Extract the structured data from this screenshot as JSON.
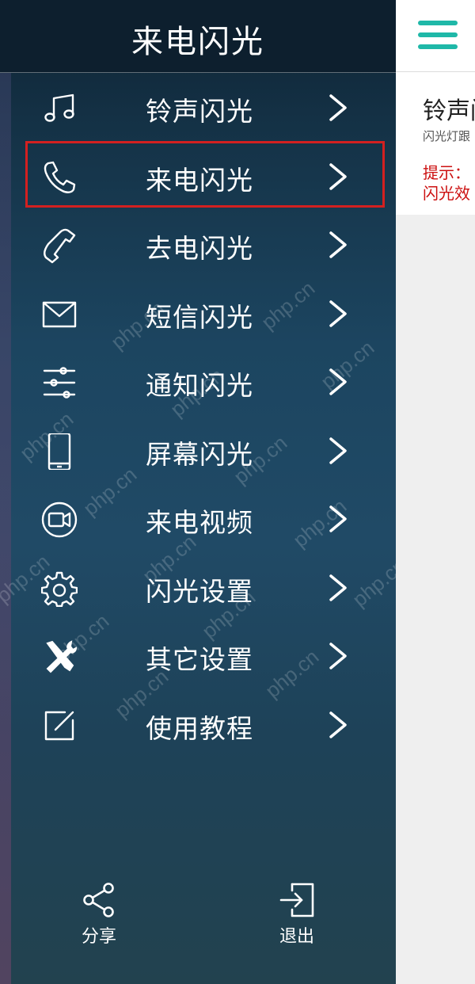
{
  "drawer": {
    "title": "来电闪光",
    "items": [
      {
        "label": "铃声闪光",
        "icon": "music-note-icon"
      },
      {
        "label": "来电闪光",
        "icon": "phone-incoming-icon"
      },
      {
        "label": "去电闪光",
        "icon": "phone-handset-icon"
      },
      {
        "label": "短信闪光",
        "icon": "envelope-icon"
      },
      {
        "label": "通知闪光",
        "icon": "sliders-icon"
      },
      {
        "label": "屏幕闪光",
        "icon": "smartphone-icon"
      },
      {
        "label": "来电视频",
        "icon": "video-call-icon"
      },
      {
        "label": "闪光设置",
        "icon": "gear-icon"
      },
      {
        "label": "其它设置",
        "icon": "tools-icon"
      },
      {
        "label": "使用教程",
        "icon": "edit-icon"
      }
    ],
    "share_label": "分享",
    "exit_label": "退出",
    "selected_index": 1
  },
  "content": {
    "card_title": "铃声闪",
    "card_desc": "闪光灯跟",
    "tip_line1": "提示：",
    "tip_line2": "闪光效"
  },
  "watermark_text": "php.cn",
  "colors": {
    "accent": "#1fb8a8",
    "highlight_border": "#d32020",
    "tip_text": "#cc1010"
  }
}
